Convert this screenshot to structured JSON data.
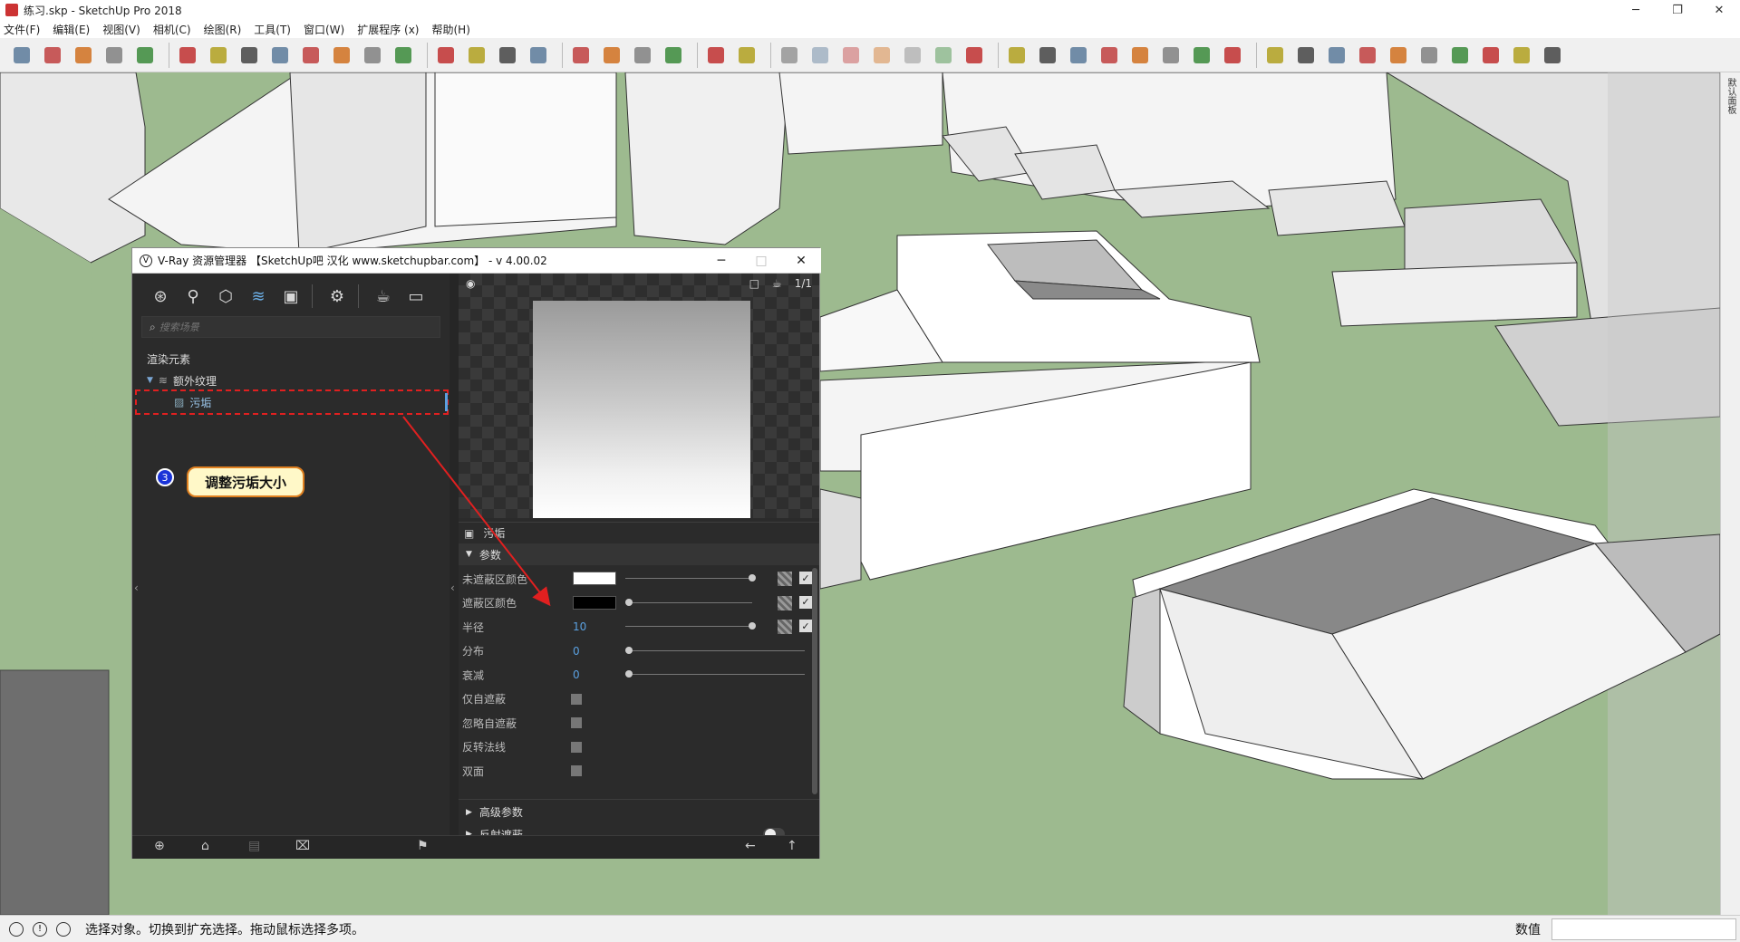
{
  "window": {
    "title": "练习.skp - SketchUp Pro 2018",
    "min": "─",
    "max": "❐",
    "close": "✕"
  },
  "menu": [
    "文件(F)",
    "编辑(E)",
    "视图(V)",
    "相机(C)",
    "绘图(R)",
    "工具(T)",
    "窗口(W)",
    "扩展程序 (x)",
    "帮助(H)"
  ],
  "toolbar_icons": [
    "select-icon",
    "eraser-icon",
    "pencil-icon",
    "arc-icon",
    "rectangle-icon",
    "push-pull-icon",
    "follow-me-icon",
    "move-icon",
    "rotate-icon",
    "scale-icon",
    "tape-measure-icon",
    "text-icon",
    "paint-bucket-icon",
    "orbit-icon",
    "pan-icon",
    "zoom-icon",
    "zoom-extents-icon",
    "warehouse-icon",
    "extension-warehouse-icon",
    "layout-icon",
    "ruby-icon",
    "solid-union-icon",
    "solid-subtract-icon",
    "xray-icon",
    "wireframe-icon",
    "hidden-line-icon",
    "shaded-icon",
    "textured-icon",
    "monochrome-icon",
    "component-icon",
    "vray-logo-icon",
    "teapot-render-icon",
    "interactive-render-icon",
    "frame-buffer-icon",
    "batch-icon",
    "viewport-render-icon",
    "region-icon",
    "lock-icon",
    "omni-light-icon",
    "sphere-light-icon",
    "spot-light-icon",
    "ies-light-icon",
    "mesh-light-icon",
    "dome-light-icon",
    "proxy-icon",
    "fur-icon",
    "clipper-icon",
    "infinite-plane-icon"
  ],
  "right_strip": {
    "label": "默认面板"
  },
  "status": {
    "text": "选择对象。切换到扩充选择。拖动鼠标选择多项。",
    "value_label": "数值"
  },
  "vray": {
    "title": "V-Ray 资源管理器 【SketchUp吧 汉化 www.sketchupbar.com】 - v 4.00.02",
    "search_placeholder": "搜索场景",
    "tree_root": "渲染元素",
    "tree_group": "额外纹理",
    "tree_item": "污垢",
    "callout_number": "3",
    "callout_text": "调整污垢大小",
    "material_name": "污垢",
    "section": "参数",
    "params": [
      {
        "label": "未遮蔽区颜色",
        "kind": "color",
        "color": "#ffffff",
        "knob": 1.0
      },
      {
        "label": "遮蔽区颜色",
        "kind": "color",
        "color": "#000000",
        "knob": 0.0
      },
      {
        "label": "半径",
        "kind": "number",
        "value": "10",
        "knob": 1.0
      },
      {
        "label": "分布",
        "kind": "number",
        "value": "0",
        "knob": 0.0
      },
      {
        "label": "衰减",
        "kind": "number",
        "value": "0",
        "knob": 0.0
      },
      {
        "label": "仅自遮蔽",
        "kind": "check"
      },
      {
        "label": "忽略自遮蔽",
        "kind": "check"
      },
      {
        "label": "反转法线",
        "kind": "check"
      },
      {
        "label": "双面",
        "kind": "check"
      }
    ],
    "advanced": "高级参数",
    "reflection": "反射遮蔽",
    "preview_ratio": "1/1"
  }
}
